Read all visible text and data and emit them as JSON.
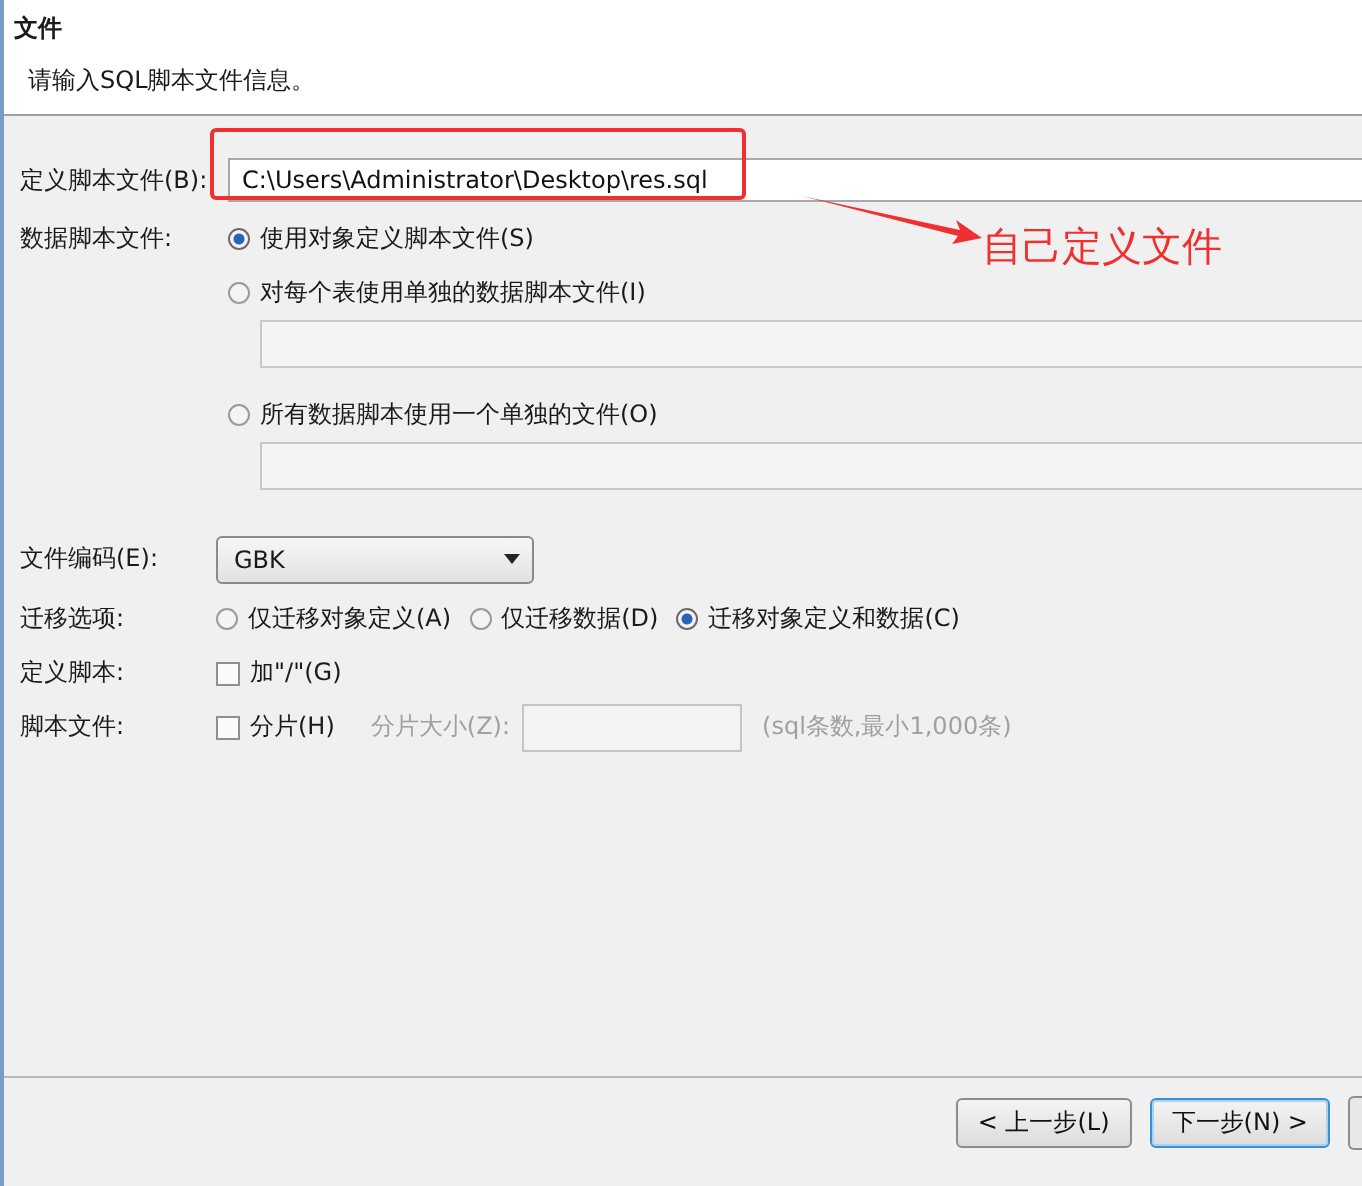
{
  "header": {
    "title": "文件",
    "subtitle": "请输入SQL脚本文件信息。"
  },
  "define_file": {
    "label": "定义脚本文件(B):",
    "value": "C:\\Users\\Administrator\\Desktop\\res.sql"
  },
  "data_file": {
    "label": "数据脚本文件:",
    "options": [
      {
        "label": "使用对象定义脚本文件(S)",
        "selected": true,
        "has_field": false
      },
      {
        "label": "对每个表使用单独的数据脚本文件(I)",
        "selected": false,
        "has_field": true
      },
      {
        "label": "所有数据脚本使用一个单独的文件(O)",
        "selected": false,
        "has_field": true
      }
    ]
  },
  "encoding": {
    "label": "文件编码(E):",
    "value": "GBK"
  },
  "migration": {
    "label": "迁移选项:",
    "options": [
      {
        "label": "仅迁移对象定义(A)",
        "selected": false
      },
      {
        "label": "仅迁移数据(D)",
        "selected": false
      },
      {
        "label": "迁移对象定义和数据(C)",
        "selected": true
      }
    ]
  },
  "definition_script": {
    "label": "定义脚本:",
    "checkbox": {
      "label": "加\"/\"(G)",
      "checked": false
    }
  },
  "script_file": {
    "label": "脚本文件:",
    "checkbox": {
      "label": "分片(H)",
      "checked": false
    },
    "size_label": "分片大小(Z):",
    "hint": "(sql条数,最小1,000条)"
  },
  "annotation": {
    "text": "自己定义文件"
  },
  "buttons": [
    {
      "label": "< 上一步(L)",
      "focused": false
    },
    {
      "label": "下一步(N) >",
      "focused": true
    }
  ]
}
